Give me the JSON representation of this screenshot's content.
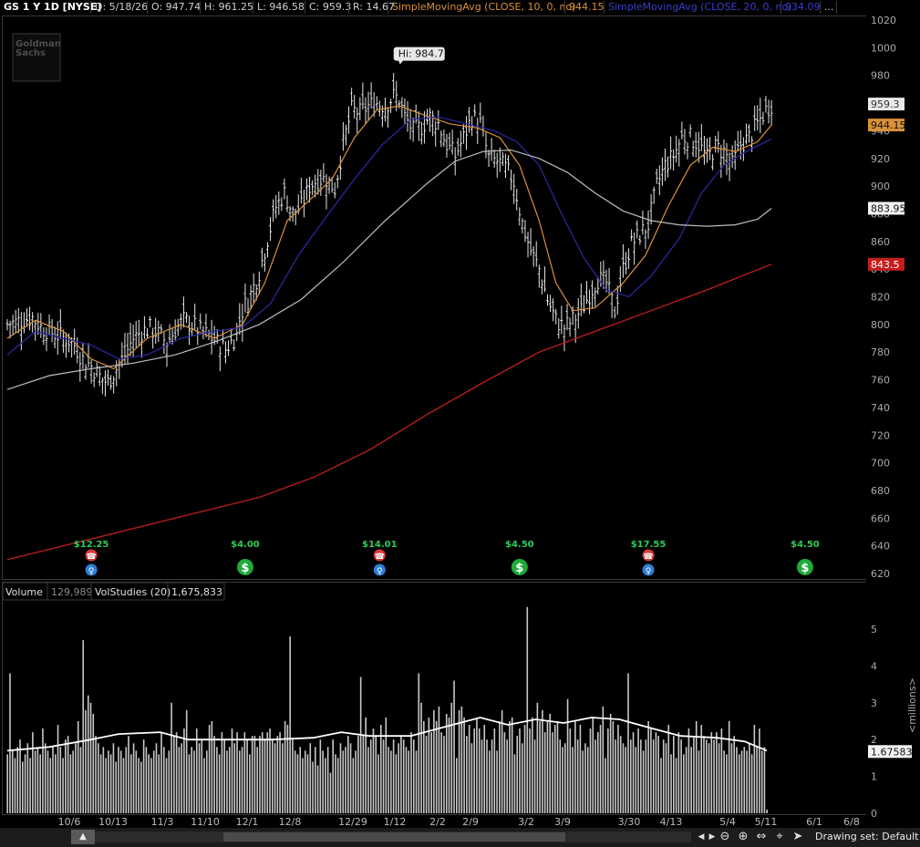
{
  "header": {
    "symbol_label": "GS 1 Y 1D [NYSE]",
    "date": "D: 5/18/26",
    "open": "O: 947.74",
    "high": "H: 961.25",
    "low": "L: 946.58",
    "close": "C: 959.3",
    "range": "R: 14.67",
    "sma10_label": "SimpleMovingAvg (CLOSE, 10, 0, no)",
    "sma10_value": "944.15",
    "sma20_label": "SimpleMovingAvg (CLOSE, 20, 0, no)",
    "sma20_value": "934.09",
    "more": "..."
  },
  "watermark": {
    "line1": "Goldman",
    "line2": "Sachs"
  },
  "volume_header": {
    "label": "Volume",
    "value": "129,989",
    "studies_label": "VolStudies (20)",
    "studies_value": "1,675,833"
  },
  "bottom_bar": {
    "drawing_set": "Drawing set: Default"
  },
  "colors": {
    "background": "#000000",
    "candle": "#e6e6e6",
    "sma10": "#d9913a",
    "sma20": "#2a2aa8",
    "sma50": "#bdbdbd",
    "sma200": "#c41e1e",
    "volume_bars": "#c8c8c8",
    "vol_avg": "#ffffff",
    "dividend": "#1faa3a",
    "earnings": "#d93a3a"
  },
  "chart_data": [
    {
      "type": "line",
      "title": "GS 1 Y 1D [NYSE]",
      "ylim": [
        620,
        1020
      ],
      "y_ticks": [
        1020,
        1000,
        980,
        960,
        940,
        920,
        900,
        880,
        860,
        840,
        820,
        800,
        780,
        760,
        740,
        720,
        700,
        680,
        660,
        640,
        620
      ],
      "x_tick_labels": [
        "10/6",
        "10/13",
        "11/3",
        "11/10",
        "12/1",
        "12/8",
        "12/29",
        "1/12",
        "2/2",
        "2/9",
        "3/2",
        "3/9",
        "3/30",
        "4/13",
        "5/4",
        "5/11",
        "6/1",
        "6/8"
      ],
      "price_anchors": [
        [
          0,
          800
        ],
        [
          5,
          803
        ],
        [
          9,
          805
        ],
        [
          12,
          798
        ],
        [
          15,
          795
        ],
        [
          18,
          792
        ],
        [
          21,
          790
        ],
        [
          24,
          785
        ],
        [
          27,
          775
        ],
        [
          30,
          770
        ],
        [
          32,
          765
        ],
        [
          34,
          760
        ],
        [
          36,
          758
        ],
        [
          39,
          768
        ],
        [
          42,
          778
        ],
        [
          45,
          790
        ],
        [
          48,
          795
        ],
        [
          51,
          797
        ],
        [
          54,
          793
        ],
        [
          57,
          787
        ],
        [
          60,
          796
        ],
        [
          63,
          803
        ],
        [
          66,
          800
        ],
        [
          69,
          795
        ],
        [
          72,
          792
        ],
        [
          75,
          787
        ],
        [
          78,
          782
        ],
        [
          81,
          790
        ],
        [
          84,
          810
        ],
        [
          87,
          822
        ],
        [
          90,
          838
        ],
        [
          93,
          862
        ],
        [
          96,
          885
        ],
        [
          99,
          895
        ],
        [
          102,
          880
        ],
        [
          105,
          885
        ],
        [
          108,
          900
        ],
        [
          111,
          905
        ],
        [
          114,
          905
        ],
        [
          117,
          898
        ],
        [
          120,
          930
        ],
        [
          123,
          955
        ],
        [
          126,
          953
        ],
        [
          129,
          958
        ],
        [
          132,
          960
        ],
        [
          135,
          958
        ],
        [
          138,
          965
        ],
        [
          140,
          963
        ],
        [
          142,
          950
        ],
        [
          145,
          940
        ],
        [
          148,
          943
        ],
        [
          151,
          950
        ],
        [
          154,
          945
        ],
        [
          157,
          930
        ],
        [
          160,
          922
        ],
        [
          163,
          935
        ],
        [
          166,
          950
        ],
        [
          169,
          945
        ],
        [
          172,
          920
        ],
        [
          175,
          918
        ],
        [
          178,
          913
        ],
        [
          181,
          903
        ],
        [
          184,
          873
        ],
        [
          187,
          853
        ],
        [
          190,
          840
        ],
        [
          193,
          818
        ],
        [
          196,
          803
        ],
        [
          199,
          798
        ],
        [
          202,
          803
        ],
        [
          205,
          810
        ],
        [
          208,
          822
        ],
        [
          211,
          833
        ],
        [
          214,
          830
        ],
        [
          217,
          810
        ],
        [
          220,
          840
        ],
        [
          223,
          858
        ],
        [
          226,
          865
        ],
        [
          229,
          872
        ],
        [
          232,
          900
        ],
        [
          235,
          915
        ],
        [
          238,
          922
        ],
        [
          241,
          935
        ],
        [
          244,
          935
        ],
        [
          247,
          930
        ],
        [
          250,
          920
        ],
        [
          253,
          928
        ],
        [
          256,
          925
        ],
        [
          259,
          915
        ],
        [
          262,
          930
        ],
        [
          265,
          935
        ],
        [
          268,
          945
        ],
        [
          271,
          955
        ],
        [
          273,
          959.3
        ]
      ],
      "high_label": "Hi: 984.7",
      "high_value": 984.7,
      "series": [
        {
          "name": "SimpleMovingAvg (CLOSE, 10, 0, no)",
          "color": "#d9913a",
          "last": 944.15,
          "points": [
            [
              0,
              790
            ],
            [
              10,
              803
            ],
            [
              20,
              795
            ],
            [
              30,
              775
            ],
            [
              38,
              768
            ],
            [
              50,
              790
            ],
            [
              62,
              800
            ],
            [
              74,
              790
            ],
            [
              84,
              800
            ],
            [
              92,
              830
            ],
            [
              100,
              875
            ],
            [
              108,
              890
            ],
            [
              116,
              905
            ],
            [
              124,
              935
            ],
            [
              132,
              955
            ],
            [
              140,
              958
            ],
            [
              148,
              952
            ],
            [
              158,
              945
            ],
            [
              168,
              942
            ],
            [
              176,
              935
            ],
            [
              183,
              915
            ],
            [
              190,
              875
            ],
            [
              196,
              830
            ],
            [
              202,
              810
            ],
            [
              210,
              812
            ],
            [
              220,
              830
            ],
            [
              228,
              850
            ],
            [
              236,
              885
            ],
            [
              244,
              915
            ],
            [
              252,
              928
            ],
            [
              260,
              925
            ],
            [
              268,
              932
            ],
            [
              273,
              944.15
            ]
          ]
        },
        {
          "name": "SimpleMovingAvg (CLOSE, 20, 0, no)",
          "color": "#2a2aa8",
          "last": 934.09,
          "points": [
            [
              0,
              778
            ],
            [
              10,
              795
            ],
            [
              20,
              790
            ],
            [
              30,
              785
            ],
            [
              40,
              775
            ],
            [
              50,
              778
            ],
            [
              62,
              790
            ],
            [
              74,
              795
            ],
            [
              84,
              798
            ],
            [
              94,
              815
            ],
            [
              104,
              850
            ],
            [
              114,
              878
            ],
            [
              124,
              905
            ],
            [
              134,
              930
            ],
            [
              144,
              948
            ],
            [
              154,
              950
            ],
            [
              164,
              945
            ],
            [
              174,
              940
            ],
            [
              182,
              932
            ],
            [
              190,
              915
            ],
            [
              198,
              880
            ],
            [
              206,
              848
            ],
            [
              214,
              825
            ],
            [
              222,
              820
            ],
            [
              230,
              835
            ],
            [
              240,
              862
            ],
            [
              248,
              895
            ],
            [
              256,
              915
            ],
            [
              264,
              925
            ],
            [
              273,
              934.09
            ]
          ]
        },
        {
          "name": "SMA 50",
          "color": "#bdbdbd",
          "last": 883.95,
          "points": [
            [
              0,
              753
            ],
            [
              15,
              763
            ],
            [
              30,
              768
            ],
            [
              45,
              772
            ],
            [
              60,
              778
            ],
            [
              75,
              788
            ],
            [
              90,
              800
            ],
            [
              105,
              818
            ],
            [
              120,
              845
            ],
            [
              135,
              875
            ],
            [
              150,
              902
            ],
            [
              160,
              918
            ],
            [
              170,
              925
            ],
            [
              180,
              926
            ],
            [
              190,
              920
            ],
            [
              200,
              910
            ],
            [
              210,
              895
            ],
            [
              220,
              882
            ],
            [
              230,
              875
            ],
            [
              240,
              872
            ],
            [
              250,
              871
            ],
            [
              260,
              872
            ],
            [
              268,
              876
            ],
            [
              273,
              883.95
            ]
          ]
        },
        {
          "name": "SMA 200",
          "color": "#c41e1e",
          "last": 843.5,
          "points": [
            [
              0,
              630
            ],
            [
              30,
              645
            ],
            [
              60,
              660
            ],
            [
              90,
              675
            ],
            [
              110,
              690
            ],
            [
              130,
              710
            ],
            [
              150,
              735
            ],
            [
              170,
              758
            ],
            [
              190,
              780
            ],
            [
              210,
              795
            ],
            [
              230,
              810
            ],
            [
              250,
              825
            ],
            [
              273,
              843.5
            ]
          ]
        }
      ],
      "price_labels": [
        "959.3",
        "944.15",
        "883.95",
        "843.5"
      ],
      "events": [
        {
          "label": "$12.25",
          "kind": "earnings",
          "x": 30
        },
        {
          "label": "$4.00",
          "kind": "dividend",
          "x": 85
        },
        {
          "label": "$14.01",
          "kind": "earnings",
          "x": 133
        },
        {
          "label": "$4.50",
          "kind": "dividend",
          "x": 183
        },
        {
          "label": "$17.55",
          "kind": "earnings",
          "x": 229
        },
        {
          "label": "$4.50",
          "kind": "dividend",
          "x": 285
        }
      ]
    },
    {
      "type": "bar",
      "title": "Volume",
      "ylabel": "<millions>",
      "ylim": [
        0,
        6
      ],
      "y_ticks": [
        5,
        4,
        3,
        2,
        1,
        0
      ],
      "current_avg_label": "1.67583",
      "volume_values": [
        1.6,
        3.8,
        1.7,
        1.5,
        1.8,
        2.0,
        1.4,
        1.6,
        1.9,
        1.5,
        2.2,
        1.7,
        1.8,
        1.6,
        2.3,
        1.9,
        1.7,
        1.5,
        1.8,
        1.6,
        2.4,
        1.8,
        1.5,
        2.0,
        2.1,
        1.6,
        1.7,
        1.9,
        2.5,
        1.8,
        4.7,
        2.8,
        3.2,
        3.0,
        2.7,
        2.1,
        1.9,
        1.6,
        1.8,
        1.5,
        1.7,
        1.6,
        1.9,
        1.4,
        1.8,
        1.7,
        1.5,
        1.8,
        2.1,
        1.6,
        1.9,
        1.7,
        1.5,
        1.4,
        2.0,
        1.8,
        1.6,
        1.5,
        1.7,
        1.9,
        1.6,
        2.2,
        1.8,
        1.5,
        1.7,
        3.0,
        2.1,
        2.2,
        1.8,
        1.9,
        2.3,
        2.8,
        1.6,
        1.8,
        1.7,
        2.3,
        1.9,
        2.0,
        1.5,
        1.7,
        2.4,
        2.5,
        2.1,
        1.8,
        1.6,
        2.2,
        2.0,
        1.7,
        1.8,
        2.3,
        1.9,
        2.2,
        1.7,
        1.8,
        2.2,
        2.0,
        1.6,
        2.1,
        2.1,
        1.8,
        2.1,
        2.2,
        2.0,
        2.2,
        2.3,
        2.0,
        1.9,
        2.1,
        2.2,
        1.9,
        2.5,
        2.4,
        4.8,
        2.0,
        1.7,
        1.6,
        1.8,
        1.5,
        1.7,
        1.6,
        1.9,
        1.4,
        1.8,
        1.3,
        2.0,
        1.7,
        1.5,
        1.8,
        1.1,
        2.0,
        1.6,
        1.5,
        1.9,
        1.7,
        1.8,
        2.1,
        1.9,
        1.5,
        1.7,
        2.1,
        3.7,
        2.1,
        2.6,
        1.8,
        2.0,
        2.3,
        2.1,
        1.6,
        2.4,
        2.0,
        2.6,
        1.8,
        1.7,
        2.0,
        1.6,
        1.9,
        2.1,
        2.0,
        1.8,
        1.7,
        2.2,
        2.0,
        1.7,
        3.8,
        3.0,
        2.5,
        2.1,
        2.6,
        2.2,
        2.8,
        2.5,
        2.9,
        2.2,
        2.1,
        2.7,
        2.6,
        3.0,
        3.6,
        1.5,
        2.8,
        2.9,
        2.6,
        2.1,
        2.4,
        1.9,
        2.3,
        2.6,
        2.3,
        2.0,
        2.4,
        2.0,
        1.7,
        2.0,
        2.3,
        1.7,
        2.5,
        2.8,
        2.2,
        2.0,
        2.5,
        2.6,
        1.6,
        2.1,
        2.3,
        1.9,
        2.4,
        5.6,
        2.3,
        2.6,
        2.0,
        3.0,
        2.5,
        2.8,
        2.2,
        2.5,
        2.7,
        2.2,
        2.4,
        2.5,
        2.0,
        1.8,
        1.9,
        3.1,
        2.3,
        1.8,
        2.5,
        2.0,
        2.4,
        1.7,
        1.9,
        1.8,
        2.3,
        2.6,
        2.0,
        2.2,
        2.4,
        2.9,
        1.5,
        2.3,
        2.7,
        2.5,
        2.0,
        2.4,
        2.1,
        1.9,
        1.8,
        3.8,
        2.0,
        2.2,
        1.8,
        2.3,
        2.0,
        1.7,
        2.0,
        2.5,
        2.3,
        2.0,
        2.2,
        2.1,
        1.5,
        2.0,
        1.9,
        2.4,
        1.6,
        2.1,
        1.5,
        2.2,
        2.0,
        1.6,
        1.8,
        2.3,
        1.8,
        2.1,
        2.5,
        1.7,
        2.4,
        2.1,
        2.0,
        1.9,
        2.2,
        2.0,
        2.2,
        1.9,
        2.3,
        1.7,
        1.6,
        2.5,
        1.9,
        2.1,
        1.8,
        1.6,
        1.7,
        1.8,
        1.7,
        1.9,
        1.6,
        2.4,
        1.8,
        2.3,
        1.7,
        1.8,
        0.1
      ],
      "avg_points": [
        [
          0,
          1.7
        ],
        [
          15,
          1.8
        ],
        [
          30,
          2.0
        ],
        [
          40,
          2.15
        ],
        [
          55,
          2.2
        ],
        [
          65,
          2.0
        ],
        [
          80,
          2.0
        ],
        [
          95,
          2.0
        ],
        [
          110,
          2.05
        ],
        [
          120,
          2.2
        ],
        [
          130,
          2.1
        ],
        [
          145,
          2.1
        ],
        [
          160,
          2.4
        ],
        [
          170,
          2.6
        ],
        [
          180,
          2.4
        ],
        [
          190,
          2.55
        ],
        [
          200,
          2.45
        ],
        [
          210,
          2.6
        ],
        [
          220,
          2.55
        ],
        [
          232,
          2.3
        ],
        [
          242,
          2.1
        ],
        [
          255,
          2.05
        ],
        [
          265,
          1.95
        ],
        [
          273,
          1.7
        ]
      ]
    }
  ]
}
